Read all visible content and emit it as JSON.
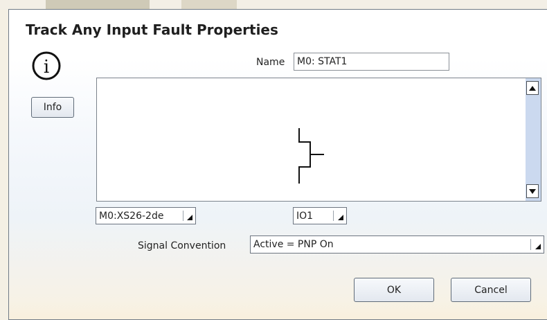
{
  "dialog": {
    "title": "Track Any Input Fault Properties",
    "info_button_label": "Info",
    "name_label": "Name",
    "name_value": "M0: STAT1",
    "module_dropdown_value": "M0:XS26-2de",
    "io_dropdown_value": "IO1",
    "signal_convention_label": "Signal Convention",
    "signal_convention_value": "Active = PNP On",
    "ok_label": "OK",
    "cancel_label": "Cancel"
  },
  "icons": {
    "info": "info-icon",
    "scroll_up": "scroll-up-arrow-icon",
    "scroll_down": "scroll-down-arrow-icon",
    "dropdown": "dropdown-arrow-icon",
    "symbol": "input-symbol-icon"
  },
  "colors": {
    "scrollbar": "#cbd9ef",
    "border": "#6f7a86"
  }
}
